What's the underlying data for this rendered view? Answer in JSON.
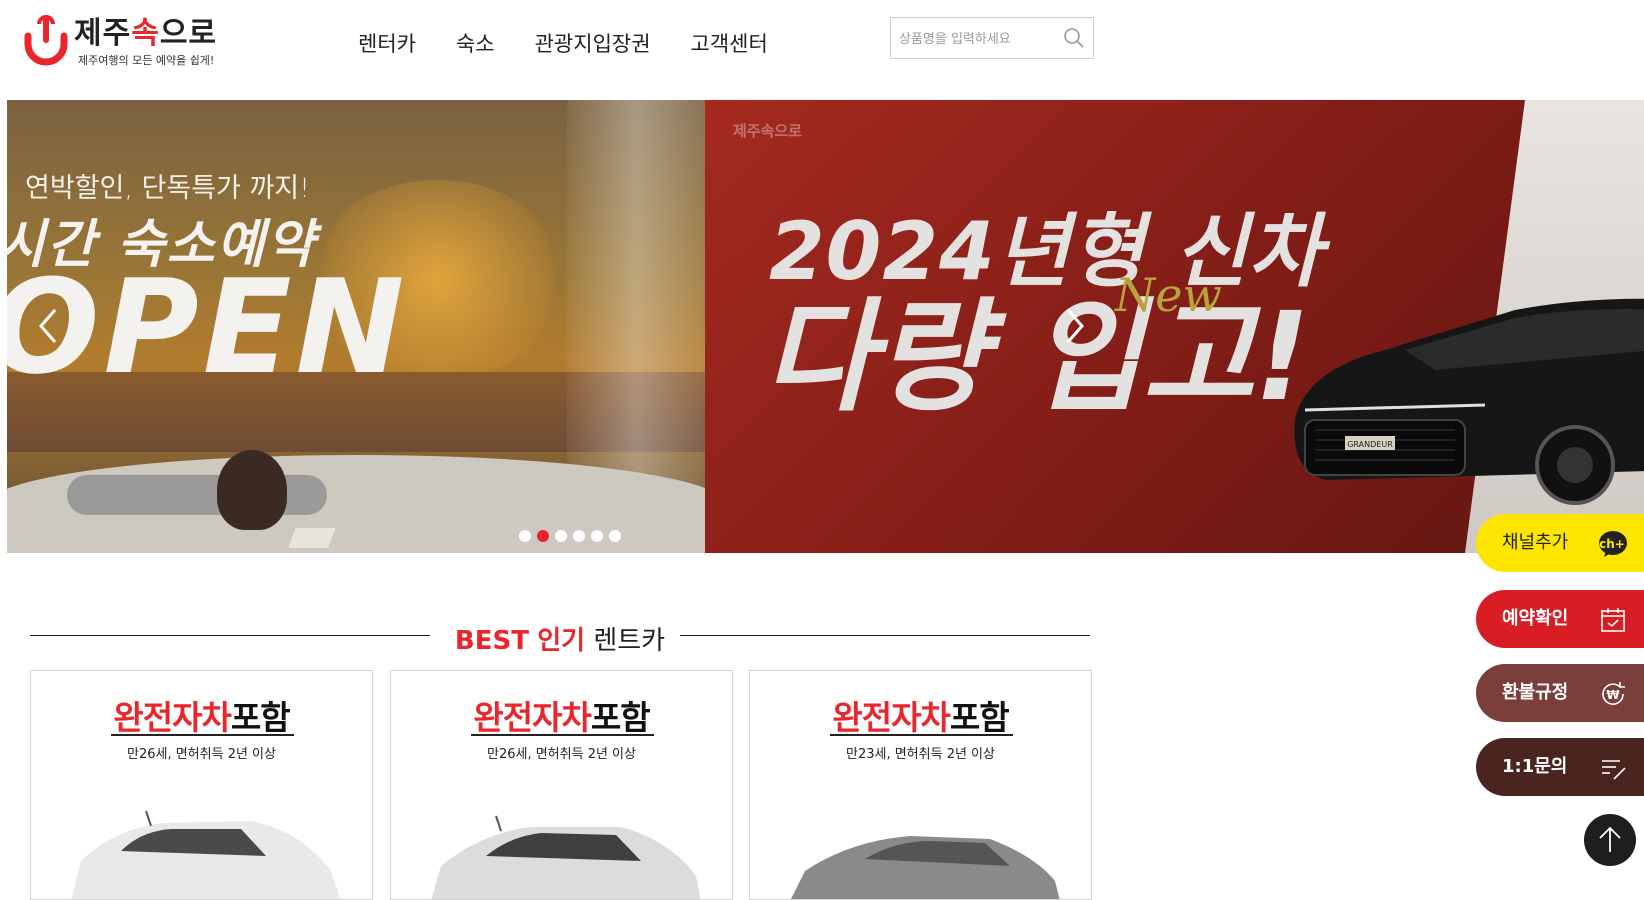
{
  "logo": {
    "title_part1": "제주",
    "title_accent": "속",
    "title_part2": "으로",
    "subtitle": "제주여행의 모든 예약을 쉽게!"
  },
  "nav": {
    "items": [
      {
        "label": "렌터카"
      },
      {
        "label": "숙소"
      },
      {
        "label": "관광지입장권"
      },
      {
        "label": "고객센터"
      }
    ]
  },
  "search": {
    "placeholder": "상품명을 입력하세요",
    "icon": "search-icon"
  },
  "banner": {
    "left_slide": {
      "subtitle": "연박할인, 단독특가 까지!",
      "headline": "시간 숙소예약",
      "big_text": "OPEN"
    },
    "right_slide": {
      "logo": "제주속으로",
      "year_text": "2024년형 신차",
      "big_text": "다량 입고!",
      "accent_text": "New",
      "car_label": "GRANDEUR"
    },
    "dots_count": 6,
    "active_dot": 1
  },
  "best_section": {
    "title_en": "BEST",
    "title_red": "인기",
    "title_rest": "렌트카"
  },
  "cards": [
    {
      "badge_red": "완전자차",
      "badge_black": "포함",
      "condition": "만26세, 면허취득 2년 이상"
    },
    {
      "badge_red": "완전자차",
      "badge_black": "포함",
      "condition": "만26세, 면허취득 2년 이상"
    },
    {
      "badge_red": "완전자차",
      "badge_black": "포함",
      "condition": "만23세, 면허취득 2년 이상"
    }
  ],
  "floating": {
    "kakao": {
      "label": "채널추가",
      "badge": "ch+"
    },
    "reserve": {
      "label": "예약확인"
    },
    "refund": {
      "label": "환불규정",
      "badge": "₩"
    },
    "qna": {
      "label": "1:1문의"
    }
  },
  "colors": {
    "accent": "#e8262b",
    "kakao": "#fde500",
    "reserve": "#d81e24",
    "refund": "#7b3f3b",
    "qna": "#4a241f",
    "top_button": "#1e1e1e"
  }
}
